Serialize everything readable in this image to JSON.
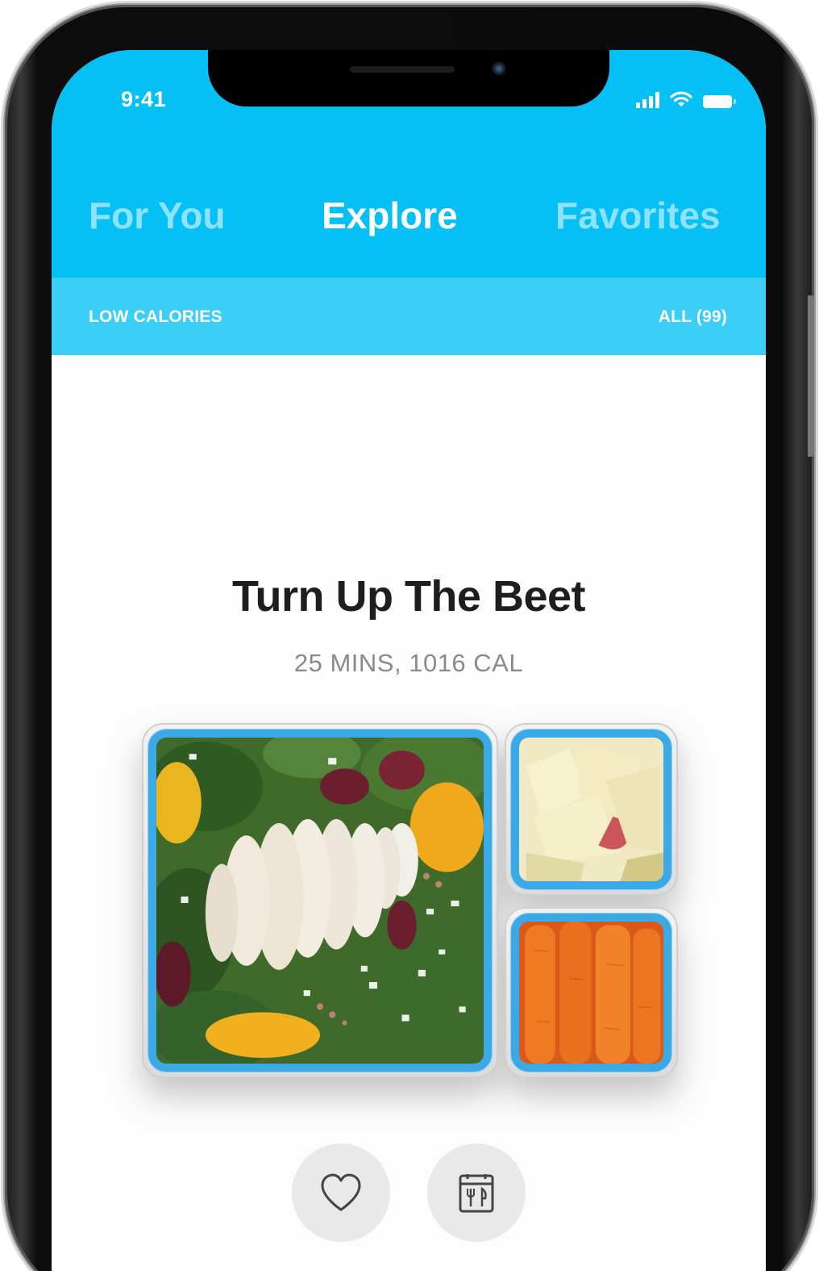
{
  "status_bar": {
    "time": "9:41"
  },
  "tabs": [
    {
      "label": "For You",
      "active": false
    },
    {
      "label": "Explore",
      "active": true
    },
    {
      "label": "Favorites",
      "active": false
    }
  ],
  "filter_bar": {
    "filter_label": "LOW CALORIES",
    "count_label": "ALL (99)"
  },
  "recipe": {
    "title": "Turn Up The Beet",
    "meta": "25 MINS, 1016 CAL"
  },
  "actions": {
    "favorite_icon": "heart-icon",
    "meal_plan_icon": "meal-calendar-icon"
  },
  "colors": {
    "header_blue": "#05c0f4",
    "subheader_blue": "#3bcef6",
    "container_blue": "#3aa9e6"
  }
}
